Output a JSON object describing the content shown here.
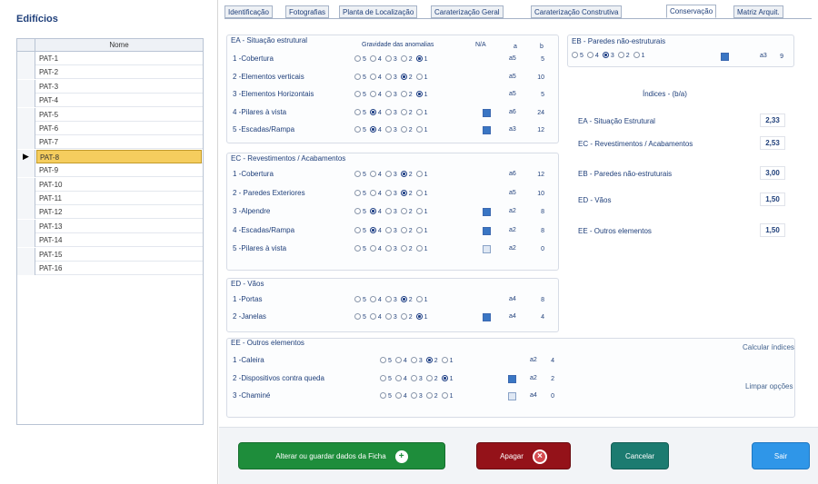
{
  "left_panel": {
    "title": "Edifícios",
    "column_header": "Nome",
    "rows": [
      "PAT-1",
      "PAT-2",
      "PAT-3",
      "PAT-4",
      "PAT-5",
      "PAT-6",
      "PAT-7",
      "PAT-8",
      "PAT-9",
      "PAT-10",
      "PAT-11",
      "PAT-12",
      "PAT-13",
      "PAT-14",
      "PAT-15",
      "PAT-16"
    ],
    "selected_row": "PAT-8",
    "row_indicator": "▶"
  },
  "tabs": [
    "Identificação",
    "Fotografias",
    "Planta de Localização",
    "Caraterização Geral",
    "Caraterização Construtiva",
    "Conservação",
    "Matriz Arquit."
  ],
  "active_tab": "Conservação",
  "gravity_header": "Gravidade das anomalias",
  "na_header": "N/A",
  "col_a": "a",
  "col_b": "b",
  "radio_levels": [
    "5",
    "4",
    "3",
    "2",
    "1"
  ],
  "ea": {
    "title": "EA - Situação estrutural",
    "rows": [
      {
        "label": "1 -Cobertura",
        "selected": "1",
        "na": false,
        "code": "a5",
        "value": "5"
      },
      {
        "label": "2 -Elementos verticais",
        "selected": "2",
        "na": false,
        "code": "a5",
        "value": "10"
      },
      {
        "label": "3 -Elementos Horizontais",
        "selected": "1",
        "na": false,
        "code": "a5",
        "value": "5"
      },
      {
        "label": "4 -Pilares à vista",
        "selected": "4",
        "na": true,
        "code": "a6",
        "value": "24"
      },
      {
        "label": "5 -Escadas/Rampa",
        "selected": "4",
        "na": true,
        "code": "a3",
        "value": "12"
      }
    ]
  },
  "ec": {
    "title": "EC - Revestimentos / Acabamentos",
    "rows": [
      {
        "label": "1 -Cobertura",
        "selected": "2",
        "na": false,
        "code": "a6",
        "value": "12"
      },
      {
        "label": "2 - Paredes Exteriores",
        "selected": "2",
        "na": false,
        "code": "a5",
        "value": "10"
      },
      {
        "label": "3 -Alpendre",
        "selected": "4",
        "na": true,
        "code": "a2",
        "value": "8"
      },
      {
        "label": "4 -Escadas/Rampa",
        "selected": "4",
        "na": true,
        "code": "a2",
        "value": "8"
      },
      {
        "label": "5 -Pilares à vista",
        "selected": "",
        "na": "light",
        "code": "a2",
        "value": "0"
      }
    ]
  },
  "ed": {
    "title": "ED - Vãos",
    "rows": [
      {
        "label": "1 -Portas",
        "selected": "2",
        "na": false,
        "code": "a4",
        "value": "8"
      },
      {
        "label": "2 -Janelas",
        "selected": "1",
        "na": true,
        "code": "a4",
        "value": "4"
      }
    ]
  },
  "ee": {
    "title": "EE - Outros elementos",
    "rows": [
      {
        "label": "1 -Caleira",
        "selected": "2",
        "na": false,
        "code": "a2",
        "value": "4"
      },
      {
        "label": "2 -Dispositivos contra queda",
        "selected": "1",
        "na": true,
        "code": "a2",
        "value": "2"
      },
      {
        "label": "3 -Chaminé",
        "selected": "",
        "na": "light",
        "code": "a4",
        "value": "0"
      }
    ]
  },
  "eb": {
    "title": "EB - Paredes não-estruturais",
    "selected": "3",
    "code": "a3",
    "value": "9"
  },
  "indices": {
    "title": "Índices - (b/a)",
    "items": [
      {
        "label": "EA - Situação Estrutural",
        "value": "2,33"
      },
      {
        "label": "EC - Revestimentos / Acabamentos",
        "value": "2,53"
      },
      {
        "label": "EB - Paredes não-estruturais",
        "value": "3,00"
      },
      {
        "label": "ED - Vãos",
        "value": "1,50"
      },
      {
        "label": "EE - Outros elementos",
        "value": "1,50"
      }
    ]
  },
  "links": {
    "calc": "Calcular índices",
    "clear": "Limpar opções"
  },
  "buttons": {
    "save": "Alterar ou guardar dados da Ficha",
    "delete": "Apagar",
    "cancel": "Cancelar",
    "exit": "Sair"
  }
}
